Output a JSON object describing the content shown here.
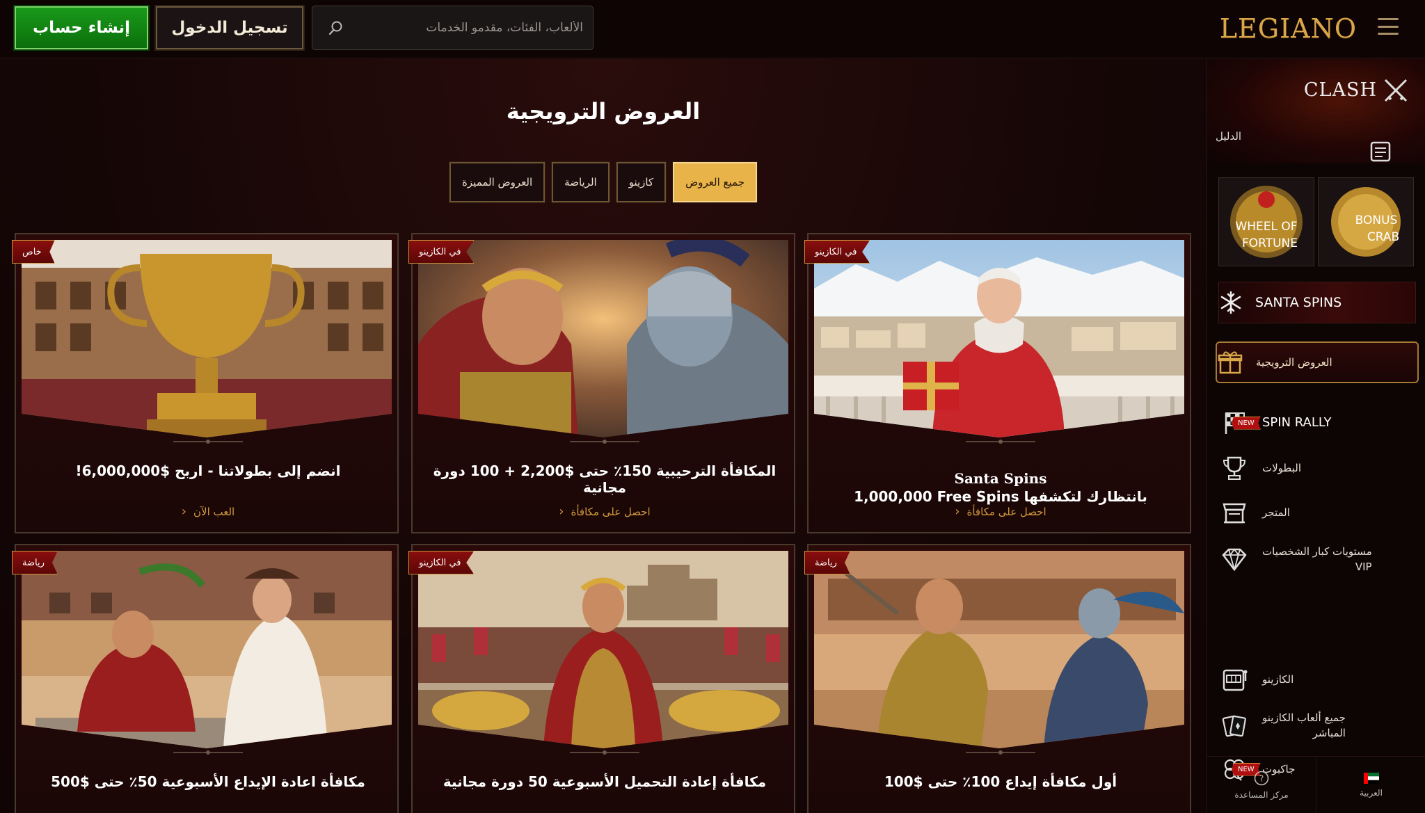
{
  "header": {
    "create_account": "إنشاء حساب",
    "login": "تسجيل الدخول",
    "search_placeholder": "الألعاب، الفئات، مقدمو الخدمات",
    "logo": "LEGIANO"
  },
  "main": {
    "title": "العروض الترويجية",
    "filters": [
      "جميع العروض",
      "كازينو",
      "الرياضة",
      "العروض المميزة"
    ],
    "active_filter": "جميع العروض",
    "cards": [
      {
        "badge": "في الكازينو",
        "title_line1": "Santa Spins",
        "title_line2": "1,000,000 Free Spins بانتظارك لتكشفها",
        "cta": "احصل على مكافأة"
      },
      {
        "badge": "في الكازينو",
        "title": "المكافأة الترحيبية 150٪ حتى $2,200 + 100 دورة مجانية",
        "cta": "احصل على مكافأة"
      },
      {
        "badge": "خاص",
        "title": "انضم إلى بطولاتنا - اربح $6,000,000!",
        "cta": "العب الآن"
      },
      {
        "badge": "رياضة",
        "title": "أول مكافأة إيداع 100٪ حتى $100",
        "cta": ""
      },
      {
        "badge": "في الكازينو",
        "title": "مكافأة إعادة التحميل الأسبوعية 50 دورة مجانية",
        "cta": ""
      },
      {
        "badge": "رياضة",
        "title": "مكافأة اعادة الإيداع الأسبوعية 50٪ حتى $500",
        "cta": ""
      }
    ]
  },
  "sidebar": {
    "clash": "CLASH",
    "guide": "الدليل",
    "tiles": [
      {
        "line1": "BONUS",
        "line2": "CRAB"
      },
      {
        "line1": "WHEEL OF",
        "line2": "FORTUNE"
      }
    ],
    "santa_spins": "SANTA SPINS",
    "promotions": "العروض الترويجية",
    "items": [
      {
        "label": "SPIN RALLY",
        "new": "NEW",
        "icon": "checkered-flag-icon"
      },
      {
        "label": "البطولات",
        "icon": "trophy-icon"
      },
      {
        "label": "المتجر",
        "icon": "shop-icon"
      },
      {
        "label": "مستويات كبار الشخصيات",
        "label2": "VIP",
        "icon": "diamond-icon"
      },
      {
        "label": "الكازينو",
        "icon": "slot-machine-icon"
      },
      {
        "label": "جميع ألعاب الكازينو",
        "label2": "المباشر",
        "icon": "cards-icon"
      },
      {
        "label": "جاكبوت",
        "new": "NEW",
        "icon": "clover-icon"
      }
    ],
    "footer": {
      "language": "العربية",
      "help": "مركز المساعدة"
    }
  },
  "colors": {
    "accent_gold": "#e8b44a",
    "create_green": "#1a9a1a",
    "badge_red": "#8a0e0e",
    "cta_gold": "#d39a3c"
  }
}
